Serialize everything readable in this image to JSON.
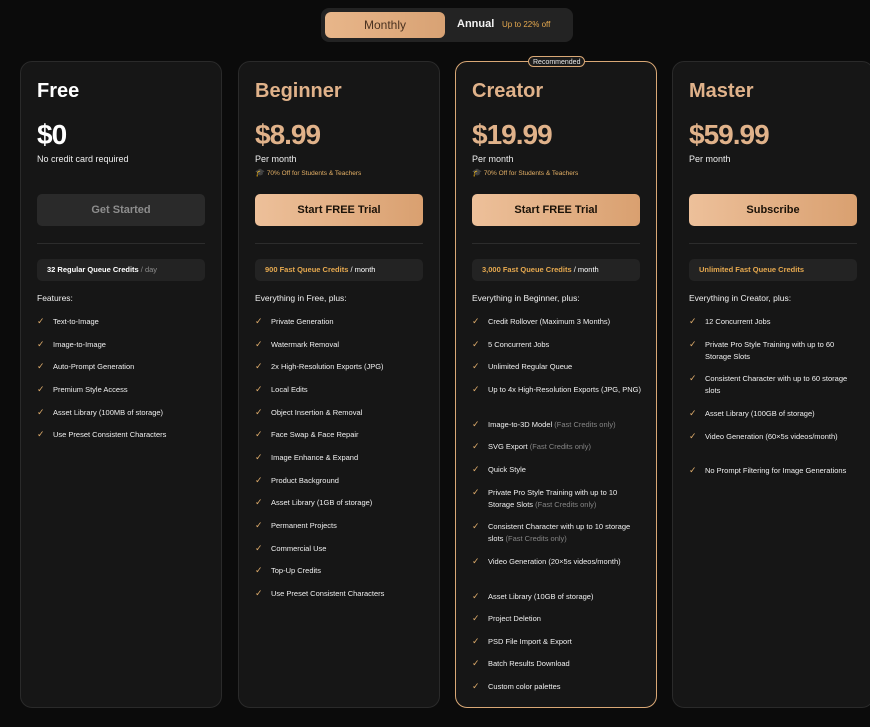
{
  "billing_toggle": {
    "monthly_label": "Monthly",
    "annual_label": "Annual",
    "annual_badge": "Up to 22% off"
  },
  "plans": [
    {
      "name": "Free",
      "price": "$0",
      "subtitle": "No credit card required",
      "discount": "",
      "cta": "Get Started",
      "credit_highlight": "32 Regular Queue Credits",
      "credit_unit": " / day",
      "features_heading": "Features:",
      "features": [
        {
          "text": "Text-to-Image",
          "note": ""
        },
        {
          "text": "Image-to-Image",
          "note": ""
        },
        {
          "text": "Auto-Prompt Generation",
          "note": ""
        },
        {
          "text": "Premium Style Access",
          "note": ""
        },
        {
          "text": "Asset Library (100MB of storage)",
          "note": ""
        },
        {
          "text": "Use Preset Consistent Characters",
          "note": ""
        }
      ]
    },
    {
      "name": "Beginner",
      "price": "$8.99",
      "subtitle": "Per month",
      "discount": "70% Off for Students & Teachers",
      "cta": "Start FREE Trial",
      "credit_highlight": "900 Fast Queue Credits",
      "credit_unit": " / month",
      "features_heading": "Everything in Free, plus:",
      "features": [
        {
          "text": "Private Generation",
          "note": ""
        },
        {
          "text": "Watermark Removal",
          "note": ""
        },
        {
          "text": "2x High-Resolution Exports (JPG)",
          "note": ""
        },
        {
          "text": "Local Edits",
          "note": ""
        },
        {
          "text": "Object Insertion & Removal",
          "note": ""
        },
        {
          "text": "Face Swap & Face Repair",
          "note": ""
        },
        {
          "text": "Image Enhance & Expand",
          "note": ""
        },
        {
          "text": "Product Background",
          "note": ""
        },
        {
          "text": "Asset Library (1GB of storage)",
          "note": ""
        },
        {
          "text": "Permanent Projects",
          "note": ""
        },
        {
          "text": "Commercial Use",
          "note": ""
        },
        {
          "text": "Top-Up Credits",
          "note": ""
        },
        {
          "text": "Use Preset Consistent Characters",
          "note": ""
        }
      ]
    },
    {
      "name": "Creator",
      "recommended_label": "Recommended",
      "price": "$19.99",
      "subtitle": "Per month",
      "discount": "70% Off for Students & Teachers",
      "cta": "Start FREE Trial",
      "credit_highlight": "3,000 Fast Queue Credits",
      "credit_unit": " / month",
      "features_heading": "Everything in Beginner, plus:",
      "features": [
        {
          "text": "Credit Rollover (Maximum 3 Months)",
          "note": ""
        },
        {
          "text": "5 Concurrent Jobs",
          "note": ""
        },
        {
          "text": "Unlimited Regular Queue",
          "note": ""
        },
        {
          "text": "Up to 4x High-Resolution Exports (JPG, PNG)",
          "note": ""
        },
        {
          "text": "Image-to-3D Model",
          "note": "(Fast Credits only)"
        },
        {
          "text": "SVG Export",
          "note": "(Fast Credits only)"
        },
        {
          "text": "Quick Style",
          "note": ""
        },
        {
          "text": "Private Pro Style Training with up to 10 Storage Slots",
          "note": "(Fast Credits only)"
        },
        {
          "text": "Consistent Character with up to 10 storage slots",
          "note": "(Fast Credits only)"
        },
        {
          "text": "Video Generation (20×5s videos/month)",
          "note": ""
        },
        {
          "text": "Asset Library (10GB of storage)",
          "note": ""
        },
        {
          "text": "Project Deletion",
          "note": ""
        },
        {
          "text": "PSD File Import & Export",
          "note": ""
        },
        {
          "text": "Batch Results Download",
          "note": ""
        },
        {
          "text": "Custom color palettes",
          "note": ""
        }
      ]
    },
    {
      "name": "Master",
      "price": "$59.99",
      "subtitle": "Per month",
      "discount": "",
      "cta": "Subscribe",
      "credit_highlight": "Unlimited Fast Queue Credits",
      "credit_unit": "",
      "features_heading": "Everything in Creator, plus:",
      "features": [
        {
          "text": "12 Concurrent Jobs",
          "note": ""
        },
        {
          "text": "Private Pro Style Training with up to 60 Storage Slots",
          "note": ""
        },
        {
          "text": "Consistent Character with up to 60 storage slots",
          "note": ""
        },
        {
          "text": "Asset Library (100GB of storage)",
          "note": ""
        },
        {
          "text": "Video Generation (60×5s videos/month)",
          "note": ""
        },
        {
          "text": "No Prompt Filtering for Image Generations",
          "note": ""
        }
      ]
    }
  ]
}
